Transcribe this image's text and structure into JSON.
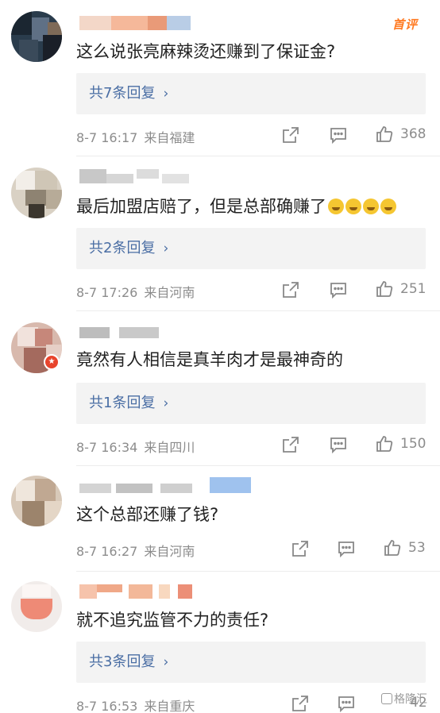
{
  "hot_badge": "首评",
  "comments": [
    {
      "content": "这么说张亮麻辣烫还赚到了保证金?",
      "replies": "共7条回复",
      "date": "8-7 16:17",
      "location": "来自福建",
      "likes": "368"
    },
    {
      "content": "最后加盟店赔了，但是总部确赚了",
      "replies": "共2条回复",
      "date": "8-7 17:26",
      "location": "来自河南",
      "likes": "251"
    },
    {
      "content": "竟然有人相信是真羊肉才是最神奇的",
      "replies": "共1条回复",
      "date": "8-7 16:34",
      "location": "来自四川",
      "likes": "150"
    },
    {
      "content": "这个总部还赚了钱?",
      "date": "8-7 16:27",
      "location": "来自河南",
      "likes": "53"
    },
    {
      "content": "就不追究监管不力的责任?",
      "replies": "共3条回复",
      "date": "8-7 16:53",
      "location": "来自重庆",
      "likes": "42"
    }
  ],
  "watermark": "格隆汇",
  "colors": {
    "reply_link": "#4a6ea4",
    "hot_badge": "#ff7a22",
    "meta": "#8c8c8c"
  }
}
